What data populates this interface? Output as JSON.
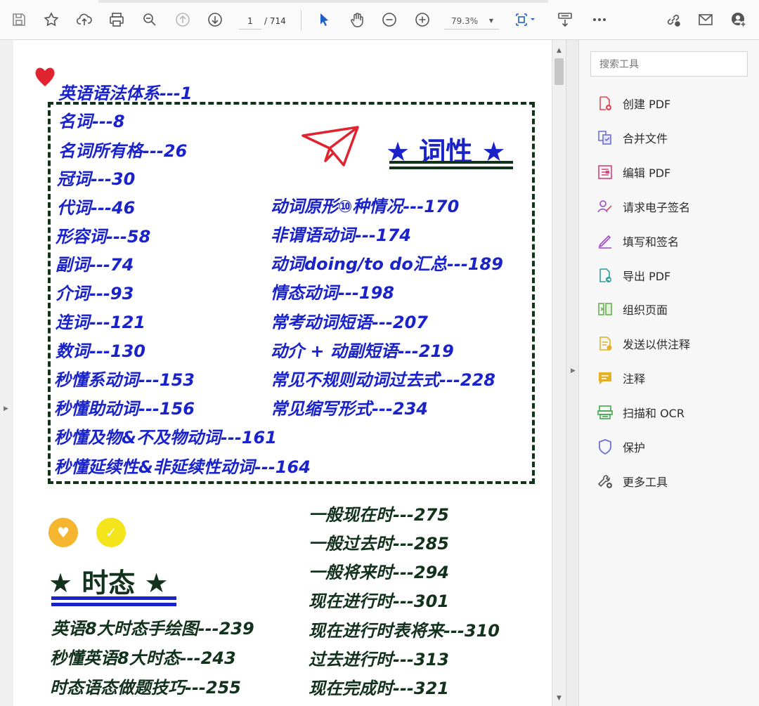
{
  "toolbar": {
    "page_current": "1",
    "page_total": "/ 714",
    "zoom": "79.3%"
  },
  "search": {
    "placeholder": "搜索工具"
  },
  "tools": [
    {
      "label": "创建 PDF",
      "icon": "create-pdf-icon",
      "color": "#e34850"
    },
    {
      "label": "合并文件",
      "icon": "combine-files-icon",
      "color": "#6e6ed8"
    },
    {
      "label": "编辑 PDF",
      "icon": "edit-pdf-icon",
      "color": "#d8427b"
    },
    {
      "label": "请求电子签名",
      "icon": "request-signature-icon",
      "color": "#9a47c6"
    },
    {
      "label": "填写和签名",
      "icon": "fill-sign-icon",
      "color": "#9a47c6"
    },
    {
      "label": "导出 PDF",
      "icon": "export-pdf-icon",
      "color": "#2e9e9e"
    },
    {
      "label": "组织页面",
      "icon": "organize-pages-icon",
      "color": "#62b24b"
    },
    {
      "label": "发送以供注释",
      "icon": "send-comments-icon",
      "color": "#e2b128"
    },
    {
      "label": "注释",
      "icon": "comment-icon",
      "color": "#e2b128"
    },
    {
      "label": "扫描和 OCR",
      "icon": "scan-ocr-icon",
      "color": "#42a84d"
    },
    {
      "label": "保护",
      "icon": "protect-icon",
      "color": "#6e6ed8"
    },
    {
      "label": "更多工具",
      "icon": "more-tools-icon",
      "color": "#555555"
    }
  ],
  "document": {
    "heading_system": "英语语法体系---1",
    "section_pos_title": "★ 词性 ★",
    "pos_left": [
      "名词---8",
      "名词所有格---26",
      "冠词---30",
      "代词---46",
      "形容词---58",
      "副词---74",
      "介词---93",
      "连词---121",
      "数词---130",
      "秒懂系动词---153",
      "秒懂助动词---156",
      "秒懂及物&不及物动词---161",
      "秒懂延续性&非延续性动词---164"
    ],
    "pos_right": [
      "动词原形⑩种情况---170",
      "非谓语动词---174",
      "动词doing/to do汇总---189",
      "情态动词---198",
      "常考动词短语---207",
      "动介 + 动副短语---219",
      "常见不规则动词过去式---228",
      "常见缩写形式---234"
    ],
    "section_tense_title": "★ 时态 ★",
    "tense_left": [
      "英语8大时态手绘图---239",
      "秒懂英语8大时态---243",
      "时态语态做题技巧---255"
    ],
    "tense_right": [
      "一般现在时---275",
      "一般过去时---285",
      "一般将来时---294",
      "现在进行时---301",
      "现在进行时表将来---310",
      "过去进行时---313",
      "现在完成时---321"
    ]
  },
  "colors": {
    "ink_blue": "#1a23c9",
    "ink_green": "#12321d",
    "heart_red": "#e0232e",
    "circle_orange": "#f5b52e",
    "circle_yellow": "#f3e41c"
  }
}
